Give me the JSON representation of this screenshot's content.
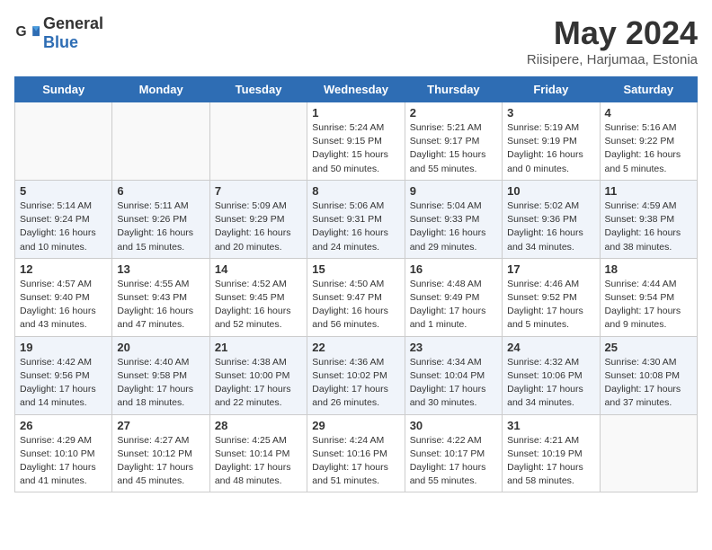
{
  "header": {
    "logo_general": "General",
    "logo_blue": "Blue",
    "month_title": "May 2024",
    "location": "Riisipere, Harjumaa, Estonia"
  },
  "weekdays": [
    "Sunday",
    "Monday",
    "Tuesday",
    "Wednesday",
    "Thursday",
    "Friday",
    "Saturday"
  ],
  "weeks": [
    [
      {
        "day": "",
        "info": ""
      },
      {
        "day": "",
        "info": ""
      },
      {
        "day": "",
        "info": ""
      },
      {
        "day": "1",
        "info": "Sunrise: 5:24 AM\nSunset: 9:15 PM\nDaylight: 15 hours\nand 50 minutes."
      },
      {
        "day": "2",
        "info": "Sunrise: 5:21 AM\nSunset: 9:17 PM\nDaylight: 15 hours\nand 55 minutes."
      },
      {
        "day": "3",
        "info": "Sunrise: 5:19 AM\nSunset: 9:19 PM\nDaylight: 16 hours\nand 0 minutes."
      },
      {
        "day": "4",
        "info": "Sunrise: 5:16 AM\nSunset: 9:22 PM\nDaylight: 16 hours\nand 5 minutes."
      }
    ],
    [
      {
        "day": "5",
        "info": "Sunrise: 5:14 AM\nSunset: 9:24 PM\nDaylight: 16 hours\nand 10 minutes."
      },
      {
        "day": "6",
        "info": "Sunrise: 5:11 AM\nSunset: 9:26 PM\nDaylight: 16 hours\nand 15 minutes."
      },
      {
        "day": "7",
        "info": "Sunrise: 5:09 AM\nSunset: 9:29 PM\nDaylight: 16 hours\nand 20 minutes."
      },
      {
        "day": "8",
        "info": "Sunrise: 5:06 AM\nSunset: 9:31 PM\nDaylight: 16 hours\nand 24 minutes."
      },
      {
        "day": "9",
        "info": "Sunrise: 5:04 AM\nSunset: 9:33 PM\nDaylight: 16 hours\nand 29 minutes."
      },
      {
        "day": "10",
        "info": "Sunrise: 5:02 AM\nSunset: 9:36 PM\nDaylight: 16 hours\nand 34 minutes."
      },
      {
        "day": "11",
        "info": "Sunrise: 4:59 AM\nSunset: 9:38 PM\nDaylight: 16 hours\nand 38 minutes."
      }
    ],
    [
      {
        "day": "12",
        "info": "Sunrise: 4:57 AM\nSunset: 9:40 PM\nDaylight: 16 hours\nand 43 minutes."
      },
      {
        "day": "13",
        "info": "Sunrise: 4:55 AM\nSunset: 9:43 PM\nDaylight: 16 hours\nand 47 minutes."
      },
      {
        "day": "14",
        "info": "Sunrise: 4:52 AM\nSunset: 9:45 PM\nDaylight: 16 hours\nand 52 minutes."
      },
      {
        "day": "15",
        "info": "Sunrise: 4:50 AM\nSunset: 9:47 PM\nDaylight: 16 hours\nand 56 minutes."
      },
      {
        "day": "16",
        "info": "Sunrise: 4:48 AM\nSunset: 9:49 PM\nDaylight: 17 hours\nand 1 minute."
      },
      {
        "day": "17",
        "info": "Sunrise: 4:46 AM\nSunset: 9:52 PM\nDaylight: 17 hours\nand 5 minutes."
      },
      {
        "day": "18",
        "info": "Sunrise: 4:44 AM\nSunset: 9:54 PM\nDaylight: 17 hours\nand 9 minutes."
      }
    ],
    [
      {
        "day": "19",
        "info": "Sunrise: 4:42 AM\nSunset: 9:56 PM\nDaylight: 17 hours\nand 14 minutes."
      },
      {
        "day": "20",
        "info": "Sunrise: 4:40 AM\nSunset: 9:58 PM\nDaylight: 17 hours\nand 18 minutes."
      },
      {
        "day": "21",
        "info": "Sunrise: 4:38 AM\nSunset: 10:00 PM\nDaylight: 17 hours\nand 22 minutes."
      },
      {
        "day": "22",
        "info": "Sunrise: 4:36 AM\nSunset: 10:02 PM\nDaylight: 17 hours\nand 26 minutes."
      },
      {
        "day": "23",
        "info": "Sunrise: 4:34 AM\nSunset: 10:04 PM\nDaylight: 17 hours\nand 30 minutes."
      },
      {
        "day": "24",
        "info": "Sunrise: 4:32 AM\nSunset: 10:06 PM\nDaylight: 17 hours\nand 34 minutes."
      },
      {
        "day": "25",
        "info": "Sunrise: 4:30 AM\nSunset: 10:08 PM\nDaylight: 17 hours\nand 37 minutes."
      }
    ],
    [
      {
        "day": "26",
        "info": "Sunrise: 4:29 AM\nSunset: 10:10 PM\nDaylight: 17 hours\nand 41 minutes."
      },
      {
        "day": "27",
        "info": "Sunrise: 4:27 AM\nSunset: 10:12 PM\nDaylight: 17 hours\nand 45 minutes."
      },
      {
        "day": "28",
        "info": "Sunrise: 4:25 AM\nSunset: 10:14 PM\nDaylight: 17 hours\nand 48 minutes."
      },
      {
        "day": "29",
        "info": "Sunrise: 4:24 AM\nSunset: 10:16 PM\nDaylight: 17 hours\nand 51 minutes."
      },
      {
        "day": "30",
        "info": "Sunrise: 4:22 AM\nSunset: 10:17 PM\nDaylight: 17 hours\nand 55 minutes."
      },
      {
        "day": "31",
        "info": "Sunrise: 4:21 AM\nSunset: 10:19 PM\nDaylight: 17 hours\nand 58 minutes."
      },
      {
        "day": "",
        "info": ""
      }
    ]
  ],
  "shaded_rows": [
    1,
    3
  ]
}
